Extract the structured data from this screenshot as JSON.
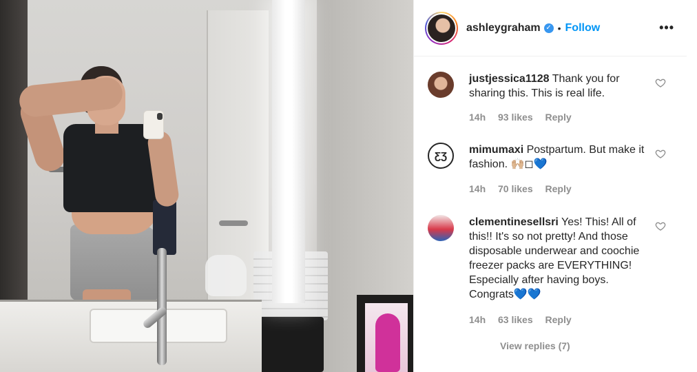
{
  "post": {
    "username": "ashleygraham",
    "verified_icon": "verified-badge-icon",
    "separator": "•",
    "follow_label": "Follow",
    "more_label": "•••"
  },
  "comments": [
    {
      "username": "justjessica1128",
      "text": "Thank you for sharing this. This is real life.",
      "time": "14h",
      "likes": "93 likes",
      "reply": "Reply"
    },
    {
      "username": "mimumaxi",
      "avatar_text": "ƸƷ",
      "text": "Postpartum. But make it fashion. 🙌🏼◻💙",
      "time": "14h",
      "likes": "70 likes",
      "reply": "Reply"
    },
    {
      "username": "clementinesellsri",
      "text": "Yes! This! All of this!! It's so not pretty! And those disposable underwear and coochie freezer packs are EVERYTHING! Especially after having boys. Congrats💙💙",
      "time": "14h",
      "likes": "63 likes",
      "reply": "Reply"
    }
  ],
  "view_replies": "View replies (7)",
  "colors": {
    "accent": "#0095f6",
    "verified": "#3897f0",
    "muted": "#8e8e8e",
    "text": "#262626"
  }
}
